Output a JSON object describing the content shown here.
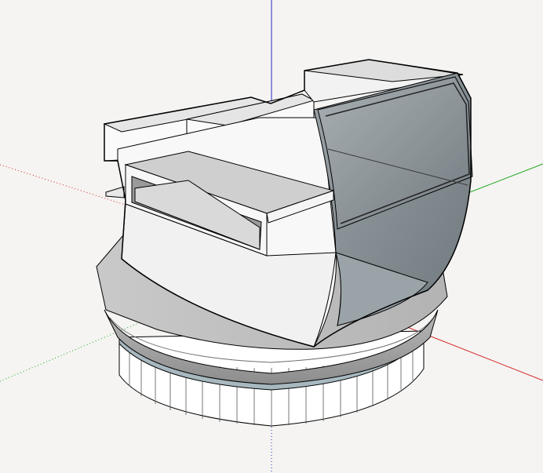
{
  "viewport": {
    "background_color": "#f5f4f2",
    "axis_colors": {
      "x_axis": "#d22525",
      "y_axis": "#19a519",
      "z_axis": "#2323c8"
    },
    "model_colors": {
      "edge": "#000000",
      "face_light": "#fbfbfb",
      "face_mid": "#e3e3e3",
      "face_shadow": "#b8b8b8",
      "glass": "#8e979c",
      "base_ring": "#9a9a9a",
      "base_band": "#a7b8bf"
    }
  }
}
